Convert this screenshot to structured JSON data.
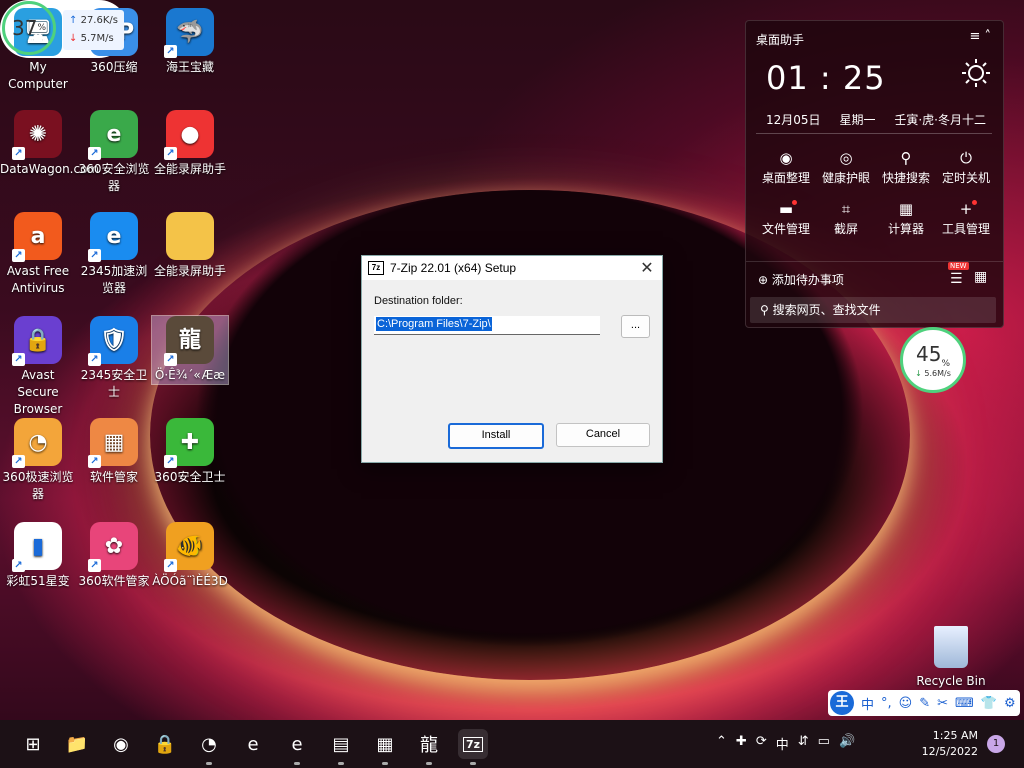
{
  "desktop_icons": [
    {
      "id": "my-computer",
      "label": "My Computer",
      "glyph": "🖥",
      "bg": "#2a9fe0",
      "shortcut": false
    },
    {
      "id": "360zip",
      "label": "360压缩",
      "glyph": "ZIP",
      "bg": "#3a8fe8",
      "shortcut": false
    },
    {
      "id": "haiwang",
      "label": "海王宝藏",
      "glyph": "🦈",
      "bg": "#1a78d0",
      "shortcut": true
    },
    {
      "id": "datawagon",
      "label": "DataWagon.com",
      "glyph": "✺",
      "bg": "#7a1020",
      "shortcut": true
    },
    {
      "id": "360browser",
      "label": "360安全浏览器",
      "glyph": "e",
      "bg": "#3aa94a",
      "shortcut": true
    },
    {
      "id": "recorder1",
      "label": "全能录屏助手",
      "glyph": "●",
      "bg": "#e33",
      "shortcut": true
    },
    {
      "id": "avast",
      "label": "Avast Free Antivirus",
      "glyph": "a",
      "bg": "#f25a1d",
      "shortcut": true
    },
    {
      "id": "2345browser",
      "label": "2345加速浏览器",
      "glyph": "e",
      "bg": "#1a8cf0",
      "shortcut": true
    },
    {
      "id": "folder",
      "label": "全能录屏助手",
      "glyph": "",
      "bg": "#f4c348",
      "shortcut": false
    },
    {
      "id": "avast-browser",
      "label": "Avast Secure Browser",
      "glyph": "🔒",
      "bg": "#6a3fd0",
      "shortcut": true
    },
    {
      "id": "2345guard",
      "label": "2345安全卫士",
      "glyph": "🛡",
      "bg": "#1a7fe8",
      "shortcut": true
    },
    {
      "id": "dragon",
      "label": "Ö·Ê¾´«Ææ",
      "glyph": "龍",
      "bg": "#5a4a3a",
      "shortcut": true
    },
    {
      "id": "360speed",
      "label": "360极速浏览器",
      "glyph": "◔",
      "bg": "#f3a53a",
      "shortcut": true
    },
    {
      "id": "softmgr",
      "label": "软件管家",
      "glyph": "▦",
      "bg": "#e84",
      "shortcut": true
    },
    {
      "id": "360guard",
      "label": "360安全卫士",
      "glyph": "✚",
      "bg": "#3ab83a",
      "shortcut": true
    },
    {
      "id": "caihong",
      "label": "彩虹51星变",
      "glyph": "▮",
      "bg": "#fff",
      "shortcut": true
    },
    {
      "id": "360softmgr",
      "label": "360软件管家",
      "glyph": "✿",
      "bg": "#e8457a",
      "shortcut": true
    },
    {
      "id": "fish3d",
      "label": "ÀÖÓã¨ìÈÉ3D",
      "glyph": "🐠",
      "bg": "#f0a020",
      "shortcut": true
    }
  ],
  "dialog": {
    "title": "7-Zip 22.01 (x64) Setup",
    "app_badge": "7z",
    "close_glyph": "✕",
    "destination_label": "Destination folder:",
    "path_value": "C:\\Program Files\\7-Zip\\",
    "browse_label": "...",
    "install_label": "Install",
    "cancel_label": "Cancel"
  },
  "widget": {
    "title": "桌面助手",
    "time": "01 : 25",
    "date": "12月05日",
    "weekday": "星期一",
    "lunar": "壬寅·虎·冬月十二",
    "tools": [
      {
        "label": "桌面整理",
        "glyph": "◉",
        "dot": false
      },
      {
        "label": "健康护眼",
        "glyph": "◎",
        "dot": false
      },
      {
        "label": "快捷搜索",
        "glyph": "⚲",
        "dot": false
      },
      {
        "label": "定时关机",
        "glyph": "⏻",
        "dot": false
      },
      {
        "label": "文件管理",
        "glyph": "▬",
        "dot": true
      },
      {
        "label": "截屏",
        "glyph": "⌗",
        "dot": false
      },
      {
        "label": "计算器",
        "glyph": "▦",
        "dot": false
      },
      {
        "label": "工具管理",
        "glyph": "+",
        "dot": true
      }
    ],
    "todo": "添加待办事项",
    "new_badge": "NEW",
    "search_placeholder": "搜索网页、查找文件"
  },
  "speed1": {
    "percent": "45",
    "unit": "%",
    "rate": "5.6M/s",
    "arrow": "↓"
  },
  "speed2": {
    "percent": "37",
    "unit": "%",
    "up_arrow": "↑",
    "up": "27.6K/s",
    "down_arrow": "↓",
    "down": "5.7M/s"
  },
  "recycle_bin": {
    "label": "Recycle Bin"
  },
  "ime": {
    "logo": "王",
    "items": [
      "中",
      "°,",
      "☺",
      "✎",
      "✂",
      "⌨",
      "👕",
      "⚙"
    ]
  },
  "taskbar": {
    "apps": [
      {
        "name": "start",
        "glyph": "⊞"
      },
      {
        "name": "explorer",
        "glyph": "📁"
      },
      {
        "name": "chrome",
        "glyph": "◉"
      },
      {
        "name": "avast-browser",
        "glyph": "🔒"
      },
      {
        "name": "360speed",
        "glyph": "◔"
      },
      {
        "name": "360browser",
        "glyph": "e"
      },
      {
        "name": "ie",
        "glyph": "e"
      },
      {
        "name": "monitor",
        "glyph": "▤"
      },
      {
        "name": "softmgr",
        "glyph": "▦"
      },
      {
        "name": "dragon",
        "glyph": "龍"
      },
      {
        "name": "7zip",
        "glyph": "7z"
      }
    ],
    "tray": [
      "⌃",
      "✚",
      "⟳",
      "中",
      "⇵",
      "▭",
      "🔊"
    ],
    "time": "1:25 AM",
    "date": "12/5/2022",
    "notifications": "1"
  }
}
